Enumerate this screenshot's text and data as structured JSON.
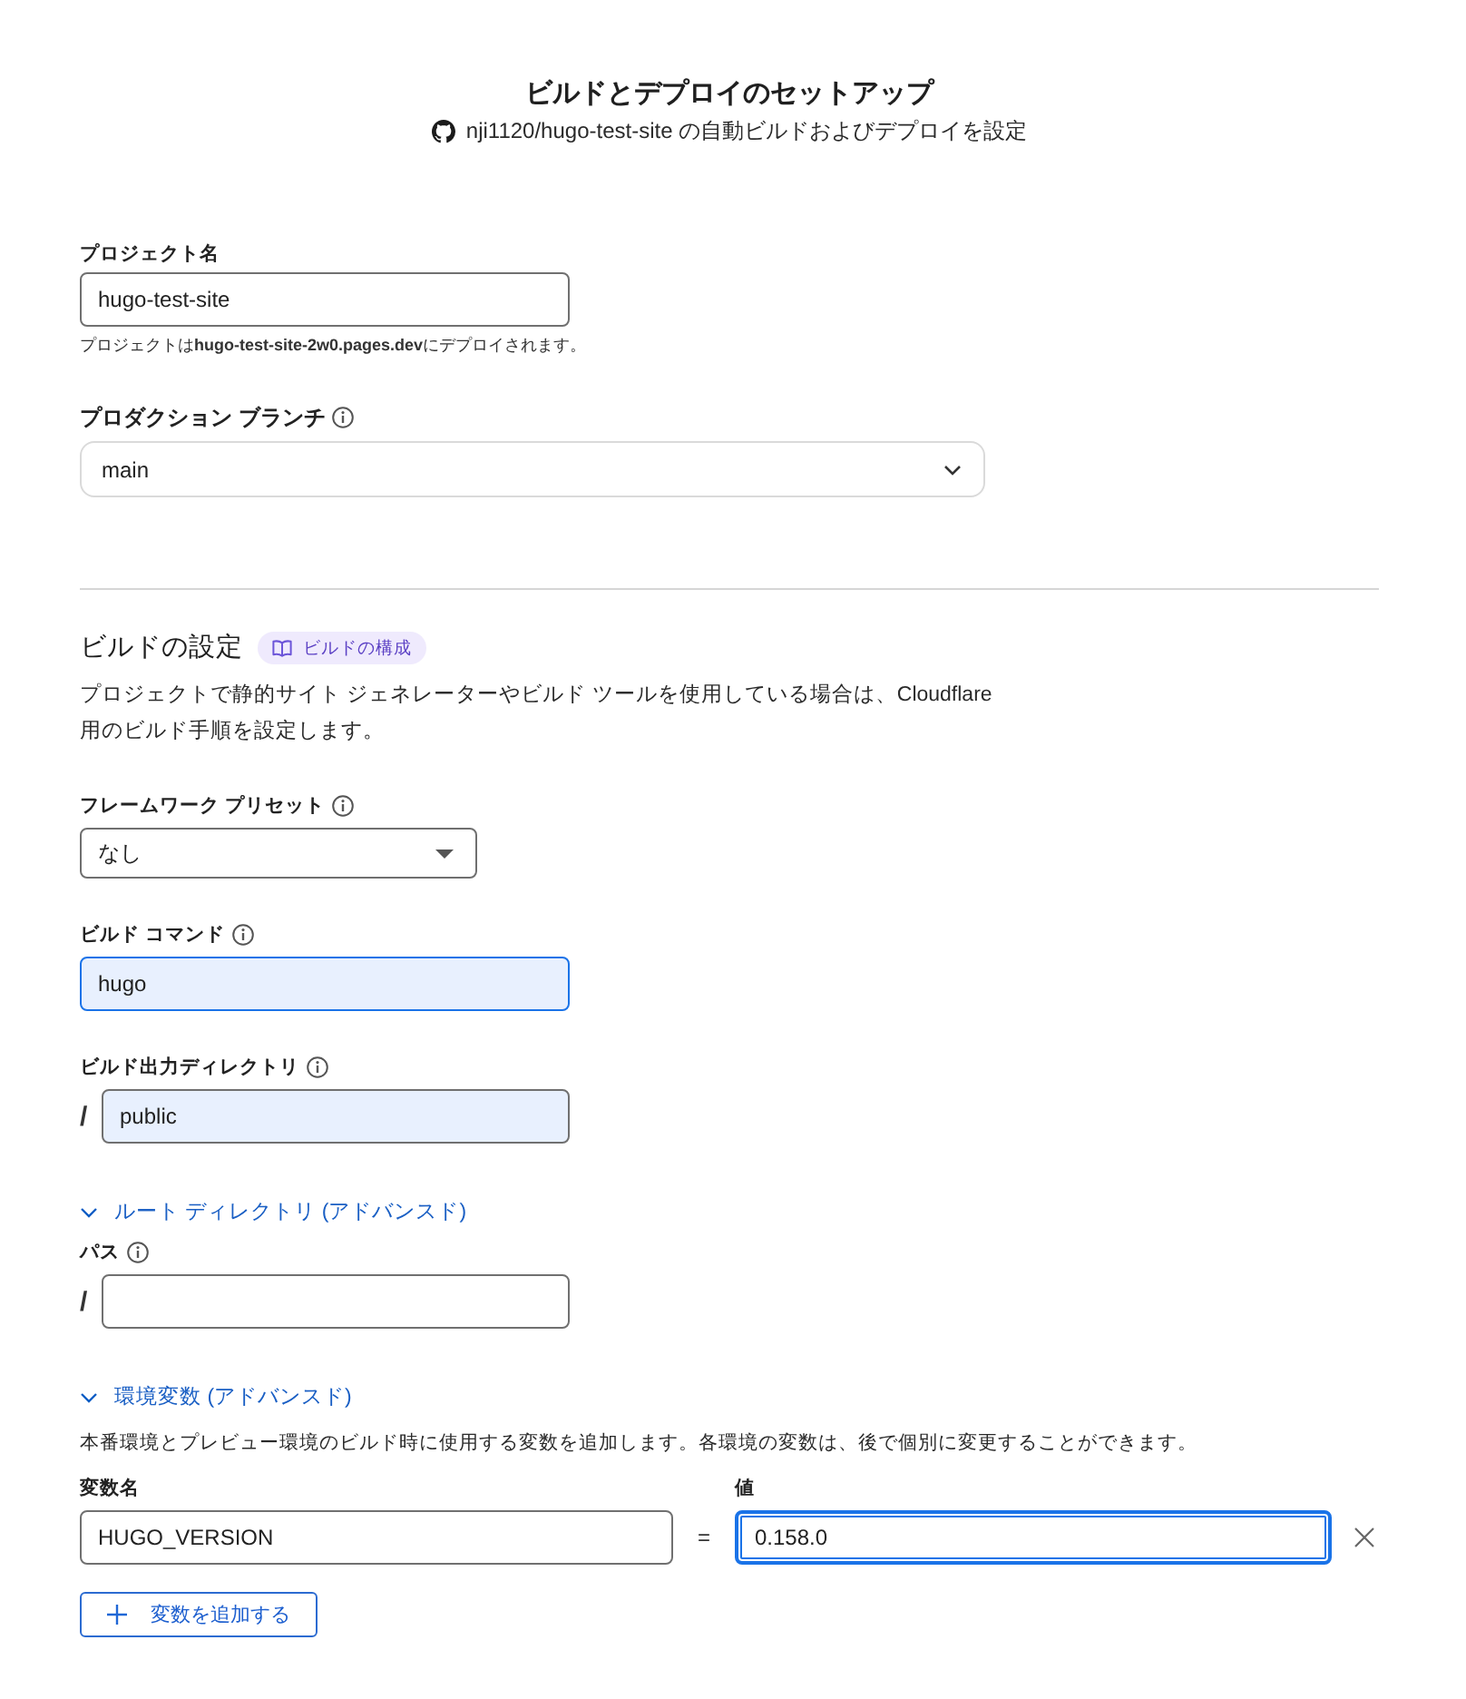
{
  "header": {
    "title": "ビルドとデプロイのセットアップ",
    "subtitle": "nji1120/hugo-test-site の自動ビルドおよびデプロイを設定"
  },
  "project": {
    "label": "プロジェクト名",
    "info": false,
    "value": "hugo-test-site",
    "hint": "プロジェクトは**hugo-test-site-2w0.pages.dev**にデプロイされます。"
  },
  "branch": {
    "label": "プロダクション ブランチ",
    "info": true,
    "value": "main"
  },
  "build": {
    "title": "ビルドの設定",
    "badge": "ビルドの構成",
    "description": "プロジェクトで静的サイト ジェネレーターやビルド ツールを使用している場合は、Cloudflare 用のビルド手順を設定します。",
    "fields": [
      {
        "kind": "preset",
        "label": "フレームワーク プリセット",
        "info": true,
        "value": "なし"
      },
      {
        "kind": "text",
        "label": "ビルド コマンド",
        "info": true,
        "value": "hugo",
        "autofilled": true,
        "focused": true
      },
      {
        "kind": "path",
        "label": "ビルド出力ディレクトリ",
        "info": true,
        "prefix": "/",
        "value": "public",
        "autofilled": true,
        "focused": false
      }
    ]
  },
  "root_directory": {
    "toggle": "ルート ディレクトリ (アドバンスド)",
    "expanded": true,
    "fields": [
      {
        "kind": "path",
        "label": "パス",
        "info": true,
        "prefix": "/",
        "autofilled": false,
        "focused": false
      }
    ]
  },
  "env": {
    "toggle": "環境変数 (アドバンスド)",
    "expanded": true,
    "description": "本番環境とプレビュー環境のビルド時に使用する変数を追加します。各環境の変数は、後で個別に変更することができます。",
    "name_label": "変数名",
    "value_label": "値",
    "variables": [
      {
        "name": "HUGO_VERSION",
        "separator": "=",
        "value": "0.158.0",
        "focused": true
      }
    ],
    "add_button": "変数を追加する"
  }
}
